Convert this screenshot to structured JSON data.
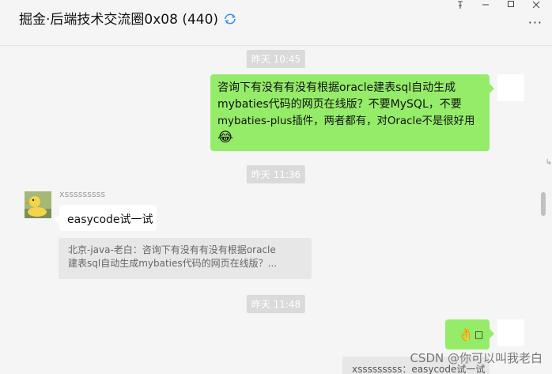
{
  "header": {
    "title": "掘金·后端技术交流圈0x08 (440)",
    "sync_icon": "sync-icon",
    "window_controls": [
      "pin-icon",
      "minimize-icon",
      "maximize-icon",
      "close-icon"
    ],
    "more_label": "···"
  },
  "messages": {
    "ts1": "昨天 10:45",
    "msg1": {
      "line1": "咨询下有没有有没有根据oracle建表sql自动生成",
      "line2": "mybaties代码的网页在线版？不要MySQL，不要",
      "line3": "mybaties-plus插件，两者都有，对Oracle不是很好用",
      "emoji": "😂"
    },
    "ts2": "昨天 11:36",
    "msg2": {
      "sender": "xsssssssss",
      "text": "easycode试一试",
      "quote_line1": "北京-java-老白：咨询下有没有有没有根据oracle",
      "quote_line2": "建表sql自动生成mybaties代码的网页在线版？..."
    },
    "ts3": "昨天 11:48",
    "msg3": {
      "emoji": "👌",
      "box": "□"
    },
    "bottom_quote": "xsssssssss：easycode试一试"
  },
  "watermark": "CSDN @你可以叫我老白",
  "colors": {
    "outgoing_bubble": "#95ec69",
    "incoming_bubble": "#ffffff",
    "timestamp_bg": "#dadada",
    "quote_bg": "#e7e7e7",
    "sync_icon_color": "#3a8ee6"
  }
}
